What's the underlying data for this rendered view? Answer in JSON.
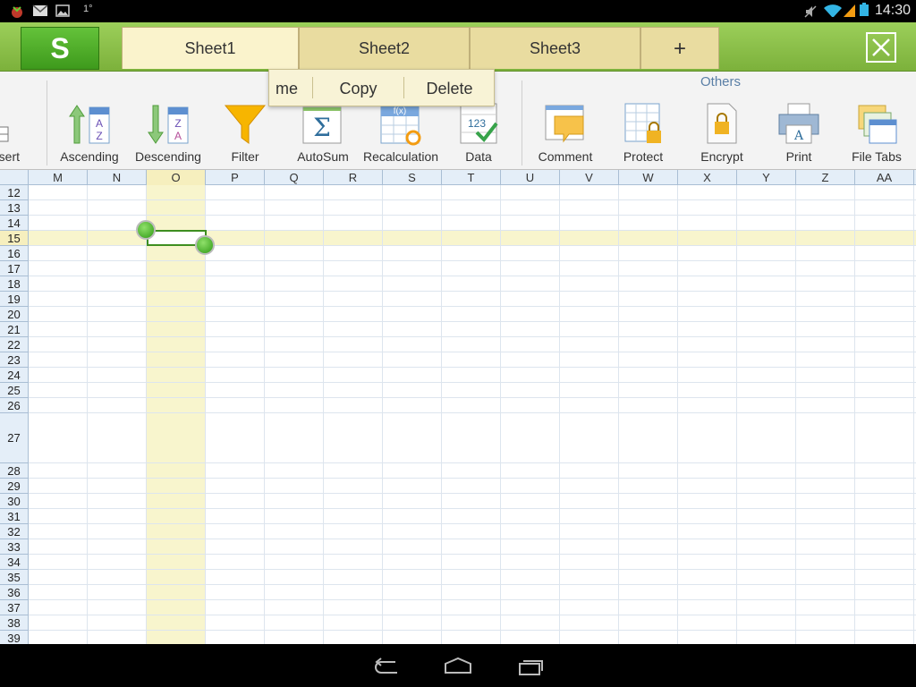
{
  "status_bar": {
    "clock": "14:30",
    "notification_text": "1°",
    "icons": [
      "app-notification-icon",
      "gmail-icon",
      "image-icon",
      "mute-icon",
      "wifi-icon",
      "signal-icon",
      "battery-icon"
    ]
  },
  "topbar": {
    "app_logo": "S",
    "tabs": [
      {
        "label": "Sheet1",
        "active": true
      },
      {
        "label": "Sheet2",
        "active": false
      },
      {
        "label": "Sheet3",
        "active": false
      }
    ],
    "add_tab": "+",
    "close_icon": "close-icon"
  },
  "context_menu": {
    "items": [
      "me",
      "Copy",
      "Delete"
    ]
  },
  "ribbon": {
    "partial_label": "sert",
    "others_group": "Others",
    "items": [
      {
        "label": "Ascending",
        "icon": "sort-ascending-icon"
      },
      {
        "label": "Descending",
        "icon": "sort-descending-icon"
      },
      {
        "label": "Filter",
        "icon": "filter-icon"
      },
      {
        "label": "AutoSum",
        "icon": "sigma-icon"
      },
      {
        "label": "Recalculation",
        "icon": "recalculation-icon"
      },
      {
        "label": "Data",
        "icon": "data-icon"
      },
      {
        "label": "Comment",
        "icon": "comment-icon"
      },
      {
        "label": "Protect",
        "icon": "protect-icon"
      },
      {
        "label": "Encrypt",
        "icon": "encrypt-icon"
      },
      {
        "label": "Print",
        "icon": "print-icon"
      },
      {
        "label": "File Tabs",
        "icon": "file-tabs-icon"
      }
    ]
  },
  "sheet": {
    "columns": [
      "M",
      "N",
      "O",
      "P",
      "Q",
      "R",
      "S",
      "T",
      "U",
      "V",
      "W",
      "X",
      "Y",
      "Z",
      "AA"
    ],
    "rows": [
      "12",
      "13",
      "14",
      "15",
      "16",
      "17",
      "18",
      "19",
      "20",
      "21",
      "22",
      "23",
      "24",
      "25",
      "26",
      "27",
      "28",
      "29",
      "30",
      "31",
      "32",
      "33",
      "34",
      "35",
      "36",
      "37",
      "38",
      "39"
    ],
    "selected_cell": "O15",
    "selected_column": "O",
    "selected_row": "15"
  },
  "colors": {
    "topbar": "#8bc34a",
    "selection": "#3e8e20",
    "highlight": "#f8f5cd"
  }
}
